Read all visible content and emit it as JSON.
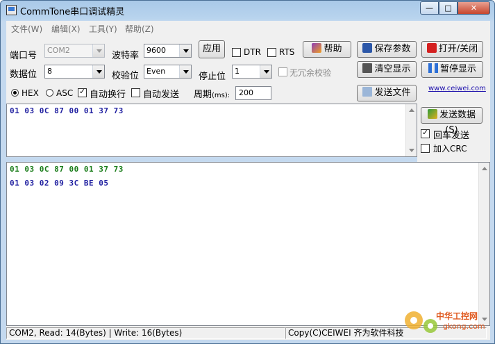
{
  "window": {
    "title": "CommTone串口调试精灵",
    "controls": {
      "min": "—",
      "max": "□",
      "close": "✕"
    }
  },
  "menu": [
    "文件(W)",
    "编辑(X)",
    "工具(Y)",
    "帮助(Z)"
  ],
  "settings": {
    "port_label": "端口号",
    "port_value": "COM2",
    "baud_label": "波特率",
    "baud_value": "9600",
    "apply_label": "应用",
    "dtr_label": "DTR",
    "rts_label": "RTS",
    "databits_label": "数据位",
    "databits_value": "8",
    "parity_label": "校验位",
    "parity_value": "Even",
    "stopbits_label": "停止位",
    "stopbits_value": "1",
    "redundant_check_label": "无冗余校验"
  },
  "toolbar": {
    "help": "帮助",
    "save_params": "保存参数",
    "open_close": "打开/关闭",
    "clear_display": "清空显示",
    "pause_display": "暂停显示",
    "send_file": "发送文件",
    "send_data": "发送数据(S)"
  },
  "options": {
    "hex": "HEX",
    "asc": "ASC",
    "auto_newline": "自动换行",
    "auto_send": "自动发送",
    "period_label": "周期",
    "period_unit": "(ms):",
    "period_value": "200",
    "enter_send": "回车发送",
    "add_crc": "加入CRC",
    "website": "www.ceiwei.com"
  },
  "send_area": {
    "lines": [
      {
        "text": "01 03 0C 87 00 01 37 73",
        "color": "#1f1fa0"
      }
    ]
  },
  "receive_area": {
    "lines": [
      {
        "text": "01 03 0C 87 00 01 37 73",
        "color": "#1a7d1a"
      },
      {
        "text": "01 03 02 09 3C BE 05",
        "color": "#1f1fa0"
      }
    ]
  },
  "status": {
    "left": "COM2, Read: 14(Bytes) | Write: 16(Bytes)",
    "right": "Copy(C)CEIWEI 齐为软件科技"
  },
  "watermark": {
    "line1": "中华工控网",
    "line2": "gkong.com"
  }
}
